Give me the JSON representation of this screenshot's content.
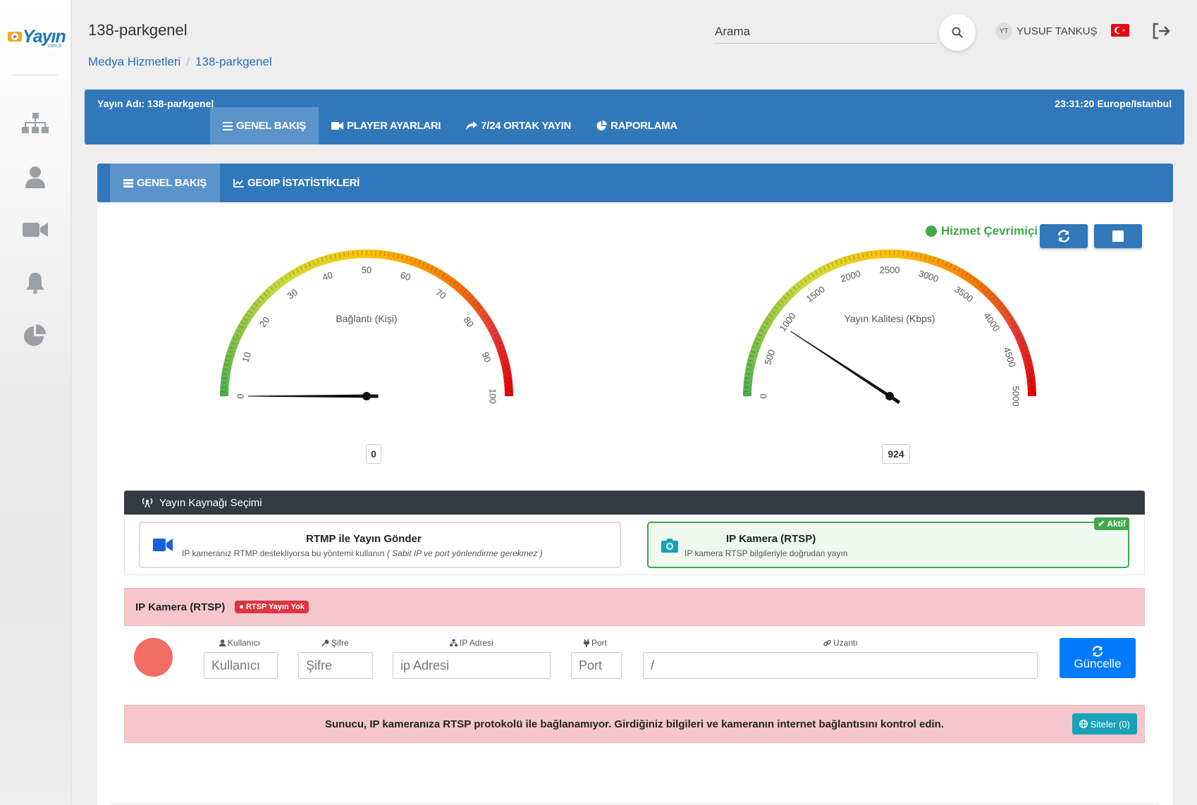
{
  "logo": {
    "text": "Yayın",
    "sub": "com.tr"
  },
  "sidebar": {
    "items": [
      {
        "icon": "sitemap-icon"
      },
      {
        "icon": "user-icon"
      },
      {
        "icon": "video-icon"
      },
      {
        "icon": "bell-icon"
      },
      {
        "icon": "pie-chart-icon"
      }
    ]
  },
  "header": {
    "title": "138-parkgenel",
    "breadcrumb": [
      "Medya Hizmetleri",
      "/",
      "138-parkgenel"
    ],
    "search": {
      "placeholder": "Arama"
    },
    "user": {
      "initials": "YT",
      "name": "YUSUF TANKUŞ"
    }
  },
  "topbar": {
    "stream_name": "Yayın Adı: 138-parkgenel",
    "clock": "23:31:20 Europe/Istanbul",
    "tabs": [
      {
        "label": "GENEL BAKIŞ",
        "active": true
      },
      {
        "label": "PLAYER AYARLARI"
      },
      {
        "label": "7/24 ORTAK YAYIN"
      },
      {
        "label": "RAPORLAMA"
      }
    ]
  },
  "subtabs": [
    {
      "label": "GENEL BAKIŞ",
      "active": true
    },
    {
      "label": "GEOIP İSTATİSTİKLERİ"
    }
  ],
  "service_status": "Hizmet Çevrimiçi",
  "gauges": [
    {
      "title": "Bağlantı (Kişi)",
      "min": 0,
      "max": 100,
      "ticks": [
        "0",
        "10",
        "20",
        "30",
        "40",
        "50",
        "60",
        "70",
        "80",
        "90",
        "100"
      ],
      "value": 0,
      "display": "0"
    },
    {
      "title": "Yayın Kalitesi (Kbps)",
      "min": 0,
      "max": 5000,
      "ticks": [
        "0",
        "500",
        "1000",
        "1500",
        "2000",
        "2500",
        "3000",
        "3500",
        "4000",
        "4500",
        "5000"
      ],
      "value": 924,
      "display": "924"
    }
  ],
  "source": {
    "heading": "Yayın Kaynağı Seçimi",
    "rtmp": {
      "title": "RTMP ile Yayın Gönder",
      "desc": "IP kameranız RTMP destekliyorsa bu yöntemi kullanın",
      "note": "( Sabit IP ve port yönlendirme gerekmez )"
    },
    "ip": {
      "title": "IP Kamera (RTSP)",
      "desc": "IP kamera RTSP bilgileriyle doğrudan yayın",
      "badge": "Aktif"
    }
  },
  "rtsp": {
    "title": "IP Kamera (RTSP)",
    "badge": "RTSP Yayın Yok",
    "fields": {
      "user": {
        "label": "Kullanıcı",
        "placeholder": "Kullanıcı"
      },
      "pass": {
        "label": "Şifre",
        "placeholder": "Şifre"
      },
      "ip": {
        "label": "IP Adresi",
        "placeholder": "ip Adresi"
      },
      "port": {
        "label": "Port",
        "placeholder": "Port"
      },
      "path": {
        "label": "Uzantı",
        "value": "/"
      }
    },
    "update_label": "Güncelle"
  },
  "error": {
    "message": "Sunucu, IP kameranıza RTSP protokolü ile bağlanamıyor. Girdiğiniz bilgileri ve kameranın internet bağlantısını kontrol edin.",
    "sites_label": "Siteler (0)"
  },
  "colors": {
    "primary": "#3178bb",
    "success": "#3fa84b",
    "danger": "#dc3545",
    "info": "#17a2b8"
  }
}
